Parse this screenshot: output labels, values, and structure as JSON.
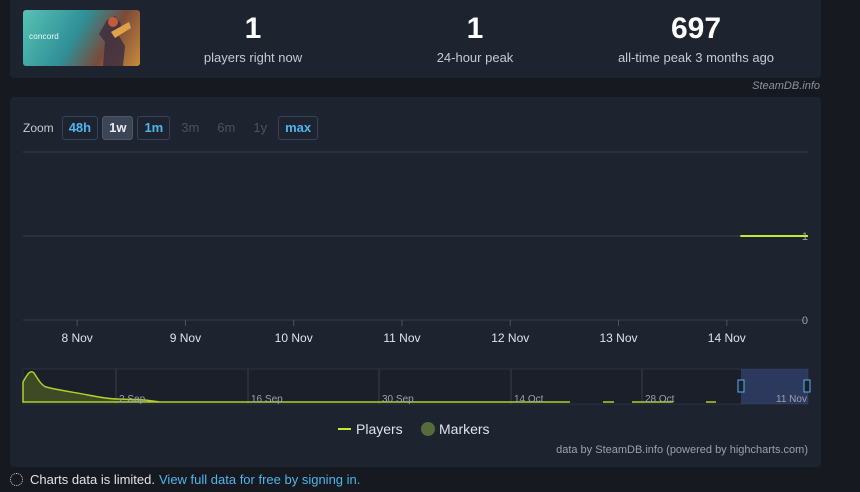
{
  "stats": [
    {
      "value": "1",
      "label": "players right now"
    },
    {
      "value": "1",
      "label": "24-hour peak"
    },
    {
      "value": "697",
      "label": "all-time peak 3 months ago"
    }
  ],
  "game_logo_text": "concord",
  "credit_top": "SteamDB.info",
  "zoom": {
    "label": "Zoom",
    "buttons": [
      {
        "label": "48h",
        "state": "enabled"
      },
      {
        "label": "1w",
        "state": "active"
      },
      {
        "label": "1m",
        "state": "enabled"
      },
      {
        "label": "3m",
        "state": "disabled"
      },
      {
        "label": "6m",
        "state": "disabled"
      },
      {
        "label": "1y",
        "state": "disabled"
      },
      {
        "label": "max",
        "state": "enabled"
      }
    ]
  },
  "chart_data": {
    "type": "line",
    "x_ticks": [
      "8 Nov",
      "9 Nov",
      "10 Nov",
      "11 Nov",
      "12 Nov",
      "13 Nov",
      "14 Nov"
    ],
    "y_ticks": [
      "0",
      "1"
    ],
    "ylim": [
      0,
      2
    ],
    "xlim": [
      "2024-11-07T12:00",
      "2024-11-14T18:00"
    ],
    "grid": true,
    "series": [
      {
        "name": "Players",
        "color": "#c6e82d",
        "points": [
          [
            "2024-11-14T03:00",
            1
          ],
          [
            "2024-11-14T18:00",
            1
          ]
        ]
      }
    ],
    "navigator": {
      "ticks": [
        "2 Sep",
        "16 Sep",
        "30 Sep",
        "14 Oct",
        "28 Oct",
        "11 Nov"
      ],
      "selected_range": [
        "2024-11-07",
        "2024-11-14"
      ]
    },
    "legend": {
      "placement": "bottom-center",
      "items": [
        {
          "label": "Players",
          "symbol": "line",
          "color": "#c6e82d"
        },
        {
          "label": "Markers",
          "symbol": "circle",
          "color": "#566a3a"
        }
      ]
    }
  },
  "chart_credit": "data by SteamDB.info (powered by highcharts.com)",
  "footer": {
    "text": "Charts data is limited.",
    "link": "View full data for free by signing in."
  }
}
